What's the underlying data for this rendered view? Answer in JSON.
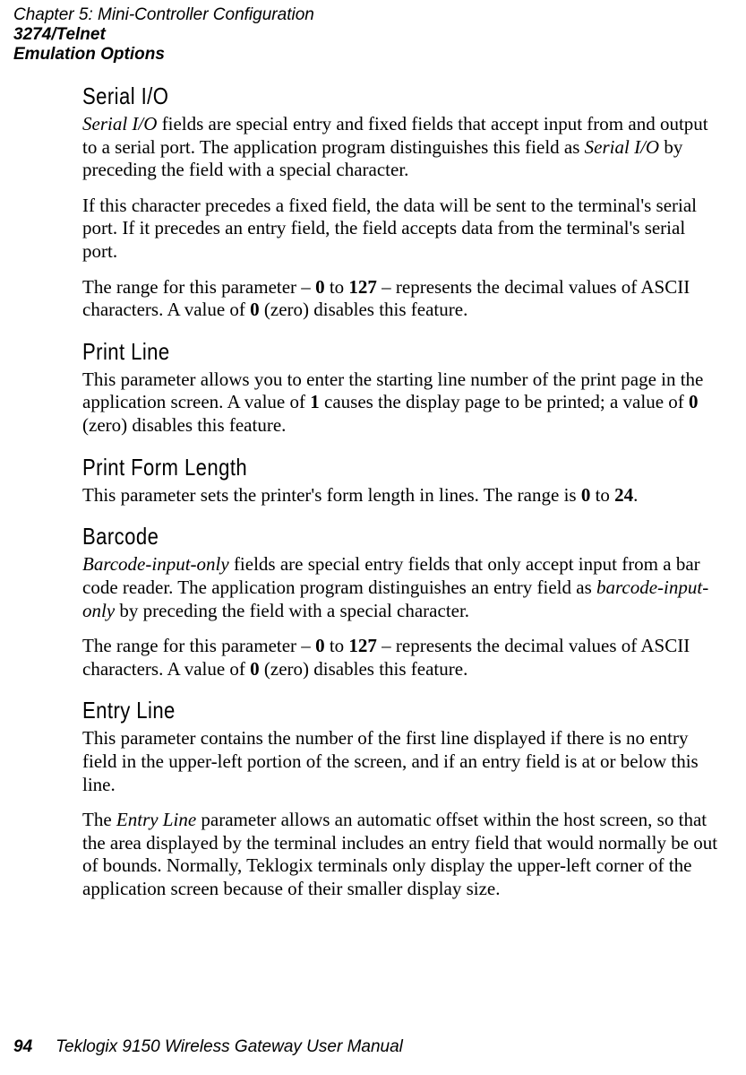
{
  "header": {
    "chapter": "Chapter 5:  Mini-Controller Configuration",
    "section1": "3274/Telnet",
    "section2": "Emulation Options"
  },
  "sections": {
    "serial_io": {
      "title": "Serial I/O",
      "p1_a": "Serial I/O",
      "p1_b": " fields are special entry and fixed fields that accept input from and output to a serial port. The application program distinguishes this field as ",
      "p1_c": "Serial I/O",
      "p1_d": " by preceding the field with a special character.",
      "p2": "If this character precedes a fixed field, the data will be sent to the terminal's serial port. If it precedes an entry field, the field accepts data from the terminal's serial port.",
      "p3_a": "The range for this parameter – ",
      "p3_b": "0",
      "p3_c": " to ",
      "p3_d": "127",
      "p3_e": " – represents the decimal values of ASCII characters. A value of ",
      "p3_f": "0",
      "p3_g": " (zero) disables this feature."
    },
    "print_line": {
      "title": "Print Line",
      "p1_a": "This parameter allows you to enter the starting line number of the print page in the application screen. A value of ",
      "p1_b": "1",
      "p1_c": " causes the display page to be printed; a value of ",
      "p1_d": "0",
      "p1_e": " (zero) disables this feature."
    },
    "print_form_length": {
      "title": "Print Form Length",
      "p1_a": "This parameter sets the printer's form length in lines. The range is ",
      "p1_b": "0",
      "p1_c": " to ",
      "p1_d": "24",
      "p1_e": "."
    },
    "barcode": {
      "title": "Barcode",
      "p1_a": "Barcode-input-only",
      "p1_b": " fields are special entry fields that only accept input from a bar code reader. The application program distinguishes an entry field as ",
      "p1_c": "barcode-input-only",
      "p1_d": " by preceding the field with a special character.",
      "p2_a": "The range for this parameter – ",
      "p2_b": "0",
      "p2_c": " to ",
      "p2_d": "127",
      "p2_e": " – represents the decimal values of ASCII characters. A value of ",
      "p2_f": "0",
      "p2_g": " (zero) disables this feature."
    },
    "entry_line": {
      "title": "Entry Line",
      "p1": "This parameter contains the number of the first line displayed if there is no entry field in the upper-left portion of the screen, and if an entry field is at or below this line.",
      "p2_a": "The ",
      "p2_b": "Entry Line",
      "p2_c": " parameter allows an automatic offset within the host screen, so that the area displayed by the terminal includes an entry field that would normally be out of bounds. Normally, Teklogix terminals only display the upper-left corner of the application screen because of their smaller display size."
    }
  },
  "footer": {
    "page": "94",
    "manual": "Teklogix 9150 Wireless Gateway User Manual"
  }
}
